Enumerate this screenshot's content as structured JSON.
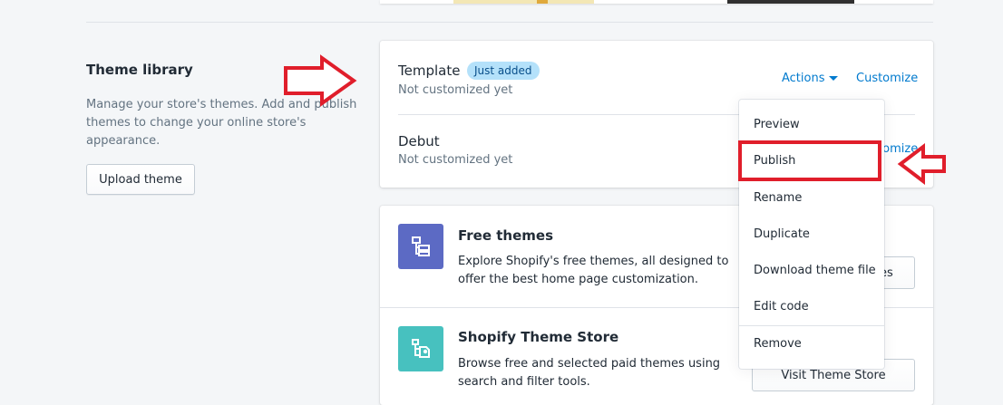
{
  "library": {
    "title": "Theme library",
    "description": "Manage your store's themes. Add and publish themes to change your online store's appearance.",
    "upload_label": "Upload theme"
  },
  "themes": [
    {
      "name": "Template",
      "badge": "Just added",
      "status": "Not customized yet",
      "actions_label": "Actions",
      "customize_label": "Customize"
    },
    {
      "name": "Debut",
      "status": "Not customized yet",
      "customize_label": "Customize"
    }
  ],
  "actions_menu": {
    "items": [
      "Preview",
      "Publish",
      "Rename",
      "Duplicate",
      "Download theme file",
      "Edit code",
      "Remove"
    ],
    "highlighted": "Publish"
  },
  "explore": {
    "free": {
      "title": "Free themes",
      "description": "Explore Shopify's free themes, all designed to offer the best home page customization.",
      "button_label": "Explore free themes",
      "icon": "layout-icon",
      "color": "#5c6ac4"
    },
    "store": {
      "title": "Shopify Theme Store",
      "description": "Browse free and selected paid themes using search and filter tools.",
      "button_label": "Visit Theme Store",
      "icon": "store-icon",
      "color": "#47c1bf"
    }
  },
  "colors": {
    "link": "#007ace",
    "badge_bg": "#b4e1fa",
    "annotation": "#e01e2b"
  }
}
